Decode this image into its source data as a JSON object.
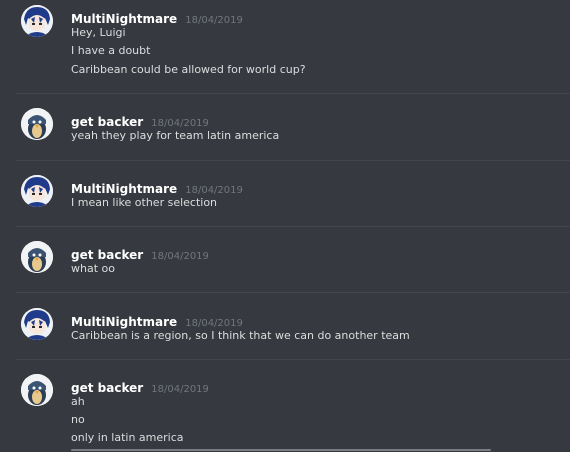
{
  "messages": [
    {
      "author": "MultiNightmare",
      "timestamp": "18/04/2019",
      "avatar": "anime-boy-avatar",
      "lines": [
        "Hey, Luigi",
        "I have a doubt",
        "Caribbean could be allowed for world cup?"
      ]
    },
    {
      "author": "get backer",
      "timestamp": "18/04/2019",
      "avatar": "penguin-avatar",
      "lines": [
        "yeah they play for team latin america"
      ]
    },
    {
      "author": "MultiNightmare",
      "timestamp": "18/04/2019",
      "avatar": "anime-boy-avatar",
      "lines": [
        "I mean like other selection"
      ]
    },
    {
      "author": "get backer",
      "timestamp": "18/04/2019",
      "avatar": "penguin-avatar",
      "lines": [
        "what oo"
      ]
    },
    {
      "author": "MultiNightmare",
      "timestamp": "18/04/2019",
      "avatar": "anime-boy-avatar",
      "lines": [
        "Caribbean is a region, so I think that we can do another team"
      ]
    },
    {
      "author": "get backer",
      "timestamp": "18/04/2019",
      "avatar": "penguin-avatar",
      "lines": [
        "ah",
        "no",
        "only in latin america"
      ]
    }
  ],
  "colors": {
    "background": "#36393f",
    "username": "#ffffff",
    "timestamp": "#72767d",
    "text": "#dcddde",
    "divider": "#42454a"
  }
}
